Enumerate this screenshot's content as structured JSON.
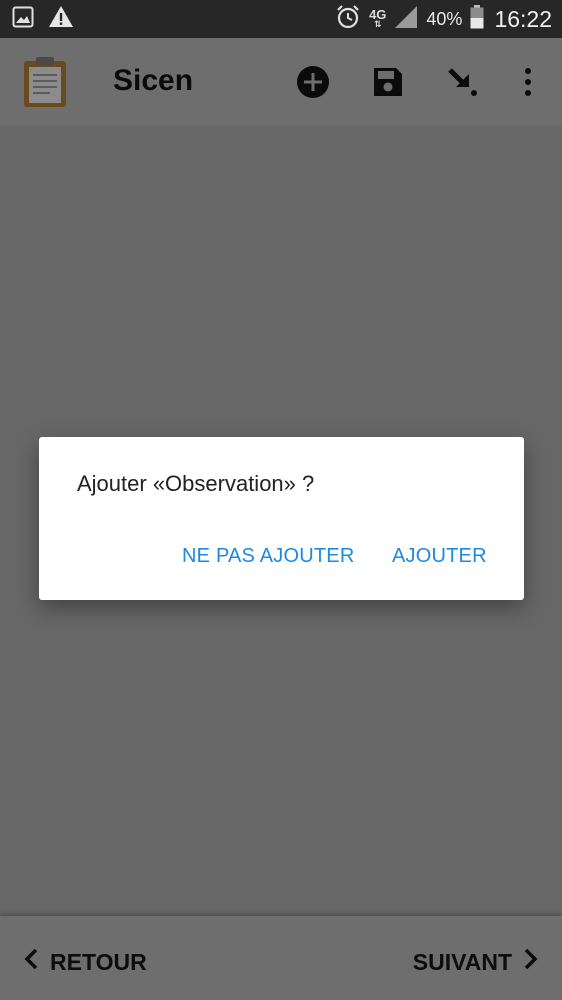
{
  "status_bar": {
    "network": "4G",
    "battery": "40%",
    "time": "16:22",
    "icons": [
      "image-icon",
      "warning-icon",
      "alarm-icon",
      "signal-icon",
      "battery-icon"
    ]
  },
  "app_bar": {
    "title": "Sicen",
    "actions": [
      "add-icon",
      "save-icon",
      "download-icon",
      "more-icon"
    ]
  },
  "dialog": {
    "message": "Ajouter «Observation» ?",
    "negative_label": "NE PAS AJOUTER",
    "positive_label": "AJOUTER"
  },
  "bottom_nav": {
    "back_label": "RETOUR",
    "next_label": "SUIVANT"
  },
  "colors": {
    "accent": "#1e88e5",
    "scrim_background": "#676767",
    "status_bar": "#272727"
  }
}
